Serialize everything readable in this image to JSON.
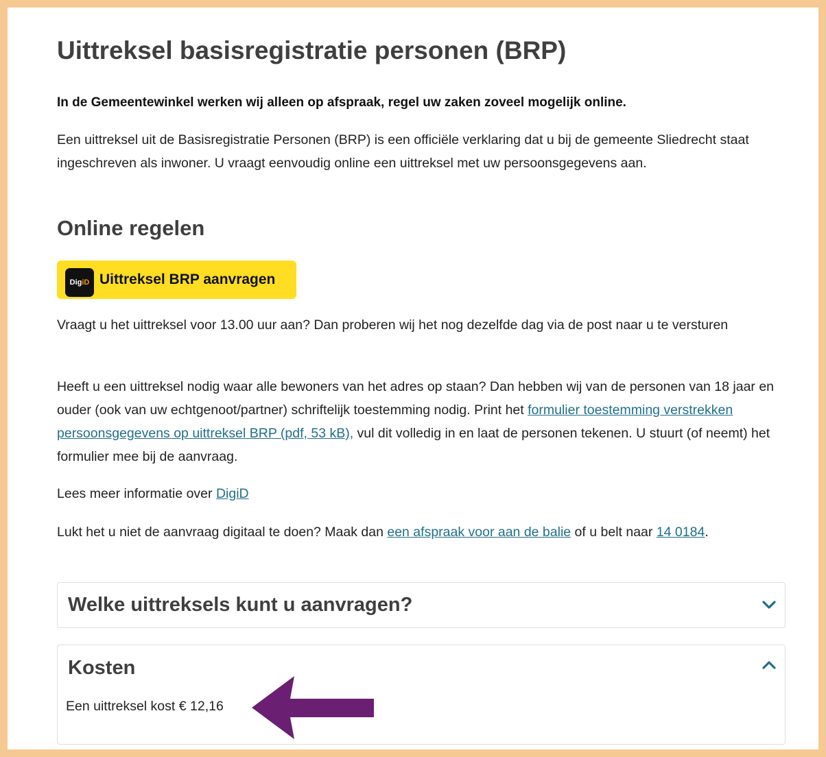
{
  "page": {
    "title": "Uittreksel basisregistratie personen (BRP)",
    "notice": "In de Gemeentewinkel werken wij alleen op afspraak, regel uw zaken zoveel mogelijk online.",
    "intro": "Een uittreksel uit de Basisregistratie Personen (BRP) is een officiële verklaring dat u bij de gemeente Sliedrecht staat ingeschreven als inwoner. U vraagt eenvoudig online een uittreksel met uw persoonsgegevens aan."
  },
  "online": {
    "heading": "Online regelen",
    "button_label": "Uittreksel BRP aanvragen",
    "logo_text_a": "Dig",
    "logo_text_b": "iD",
    "same_day": "Vraagt u het uittreksel voor 13.00 uur aan? Dan proberen wij het nog dezelfde dag via de post naar u te versturen",
    "residents_pre": "Heeft u een uittreksel nodig waar alle bewoners van het adres op staan? Dan hebben wij van de personen van 18 jaar en ouder (ook van uw echtgenoot/partner) schriftelijk toestemming nodig. Print het ",
    "residents_link": "formulier toestemming verstrekken persoonsgegevens op uittreksel BRP (pdf, 53 kB),",
    "residents_post": " vul dit volledig in en laat de personen tekenen. U stuurt (of neemt) het formulier mee bij de aanvraag.",
    "digid_pre": "Lees meer informatie over ",
    "digid_link": "DigiD",
    "help_pre": "Lukt het u niet de aanvraag digitaal te doen? Maak dan ",
    "help_link1": "een afspraak voor aan de balie",
    "help_mid": " of u belt naar ",
    "help_link2": "14 0184",
    "help_post": "."
  },
  "accordion": [
    {
      "title": "Welke uittreksels kunt u aanvragen?",
      "expanded": false
    },
    {
      "title": "Kosten",
      "expanded": true,
      "body": "Een uittreksel kost € 12,16"
    }
  ],
  "colors": {
    "border_frame": "#f6c993",
    "button_yellow": "#ffdd22",
    "link": "#1f6f8b",
    "arrow": "#6a1f72",
    "chevron": "#1f6f8b"
  }
}
